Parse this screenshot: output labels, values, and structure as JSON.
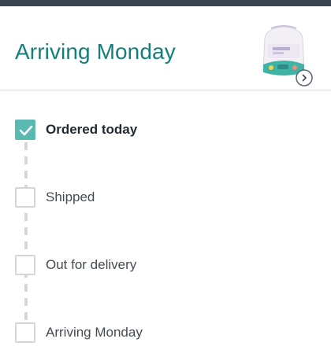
{
  "header": {
    "title": "Arriving Monday",
    "product_thumbnail": "product-image",
    "thumbnail_badge_icon": "chevron-right-icon"
  },
  "tracker": {
    "steps": [
      {
        "label": "Ordered today",
        "checked": true
      },
      {
        "label": "Shipped",
        "checked": false
      },
      {
        "label": "Out for delivery",
        "checked": false
      },
      {
        "label": "Arriving Monday",
        "checked": false
      }
    ]
  },
  "colors": {
    "accent": "#137f79",
    "check": "#5bb9b2",
    "topbar": "#3a4553"
  }
}
